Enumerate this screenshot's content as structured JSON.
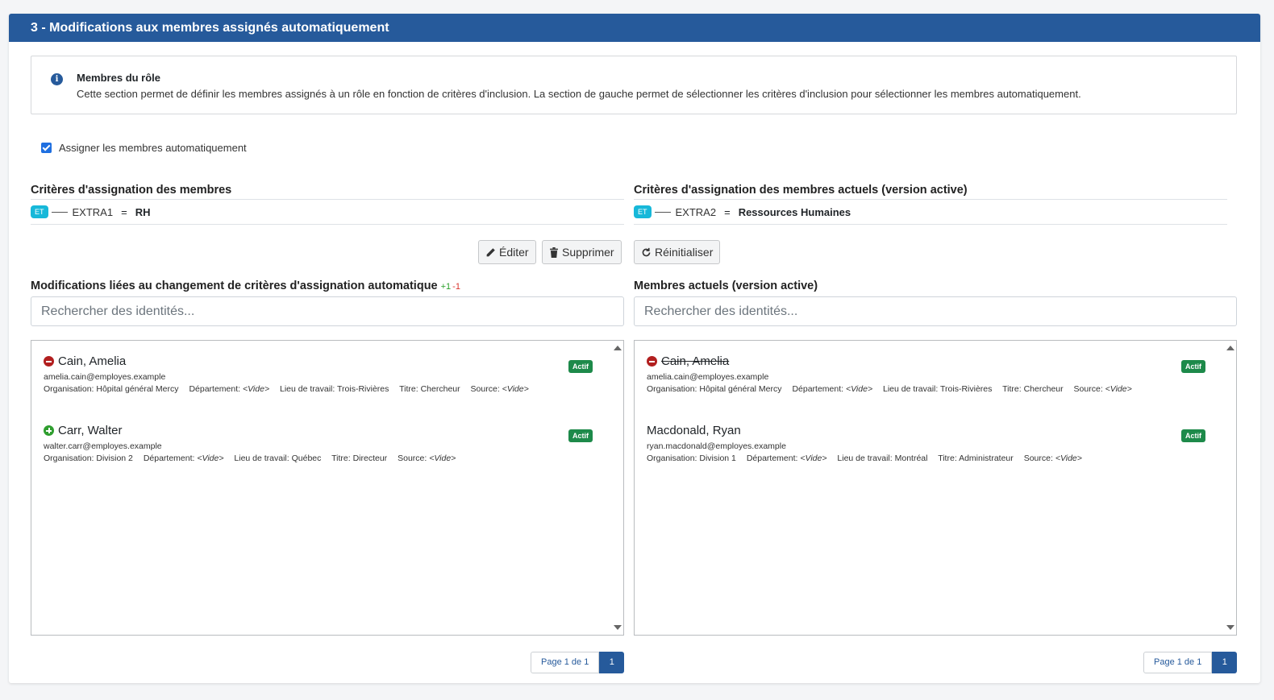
{
  "section": {
    "title": "3 - Modifications aux membres assignés automatiquement"
  },
  "info": {
    "title": "Membres du rôle",
    "text": "Cette section permet de définir les membres assignés à un rôle en fonction de critères d'inclusion. La section de gauche permet de sélectionner les critères d'inclusion pour sélectionner les membres automatiquement."
  },
  "auto_assign": {
    "label": "Assigner les membres automatiquement",
    "checked": true
  },
  "left": {
    "criteria_title": "Critères d'assignation des membres",
    "criteria": {
      "operator": "ET",
      "field": "EXTRA1",
      "eq": "=",
      "value": "RH"
    },
    "list_title": "Modifications liées au changement de critères d'assignation automatique",
    "added_count": "+1",
    "removed_count": "-1",
    "search_placeholder": "Rechercher des identités...",
    "items": [
      {
        "name": "Cain, Amelia",
        "change": "removed",
        "status": "Actif",
        "email": "amelia.cain@employes.example",
        "org_label": "Organisation:",
        "org": "Hôpital général Mercy",
        "dept_label": "Département:",
        "dept": "<Vide>",
        "loc_label": "Lieu de travail:",
        "loc": "Trois-Rivières",
        "title_label": "Titre:",
        "title": "Chercheur",
        "source_label": "Source:",
        "source": "<Vide>"
      },
      {
        "name": "Carr, Walter",
        "change": "added",
        "status": "Actif",
        "email": "walter.carr@employes.example",
        "org_label": "Organisation:",
        "org": "Division 2",
        "dept_label": "Département:",
        "dept": "<Vide>",
        "loc_label": "Lieu de travail:",
        "loc": "Québec",
        "title_label": "Titre:",
        "title": "Directeur",
        "source_label": "Source:",
        "source": "<Vide>"
      }
    ],
    "pager": {
      "info": "Page 1 de 1",
      "current": "1"
    }
  },
  "right": {
    "criteria_title": "Critères d'assignation des membres actuels (version active)",
    "criteria": {
      "operator": "ET",
      "field": "EXTRA2",
      "eq": "=",
      "value": "Ressources Humaines"
    },
    "list_title": "Membres actuels (version active)",
    "search_placeholder": "Rechercher des identités...",
    "items": [
      {
        "name": "Cain, Amelia",
        "change": "removed",
        "status": "Actif",
        "email": "amelia.cain@employes.example",
        "org_label": "Organisation:",
        "org": "Hôpital général Mercy",
        "dept_label": "Département:",
        "dept": "<Vide>",
        "loc_label": "Lieu de travail:",
        "loc": "Trois-Rivières",
        "title_label": "Titre:",
        "title": "Chercheur",
        "source_label": "Source:",
        "source": "<Vide>"
      },
      {
        "name": "Macdonald, Ryan",
        "change": "none",
        "status": "Actif",
        "email": "ryan.macdonald@employes.example",
        "org_label": "Organisation:",
        "org": "Division 1",
        "dept_label": "Département:",
        "dept": "<Vide>",
        "loc_label": "Lieu de travail:",
        "loc": "Montréal",
        "title_label": "Titre:",
        "title": "Administrateur",
        "source_label": "Source:",
        "source": "<Vide>"
      }
    ],
    "pager": {
      "info": "Page 1 de 1",
      "current": "1"
    }
  },
  "buttons": {
    "edit": "Éditer",
    "delete": "Supprimer",
    "reset": "Réinitialiser"
  },
  "icons": {
    "info": "info-icon",
    "edit": "pencil-icon",
    "delete": "trash-icon",
    "reset": "refresh-icon",
    "removed": "minus-circle-icon",
    "added": "plus-circle-icon"
  },
  "colors": {
    "header": "#265a9b",
    "operator_badge": "#17b8d9",
    "status_badge": "#1d8a4a",
    "removed": "#b21f1f",
    "added": "#2f9e2f"
  }
}
